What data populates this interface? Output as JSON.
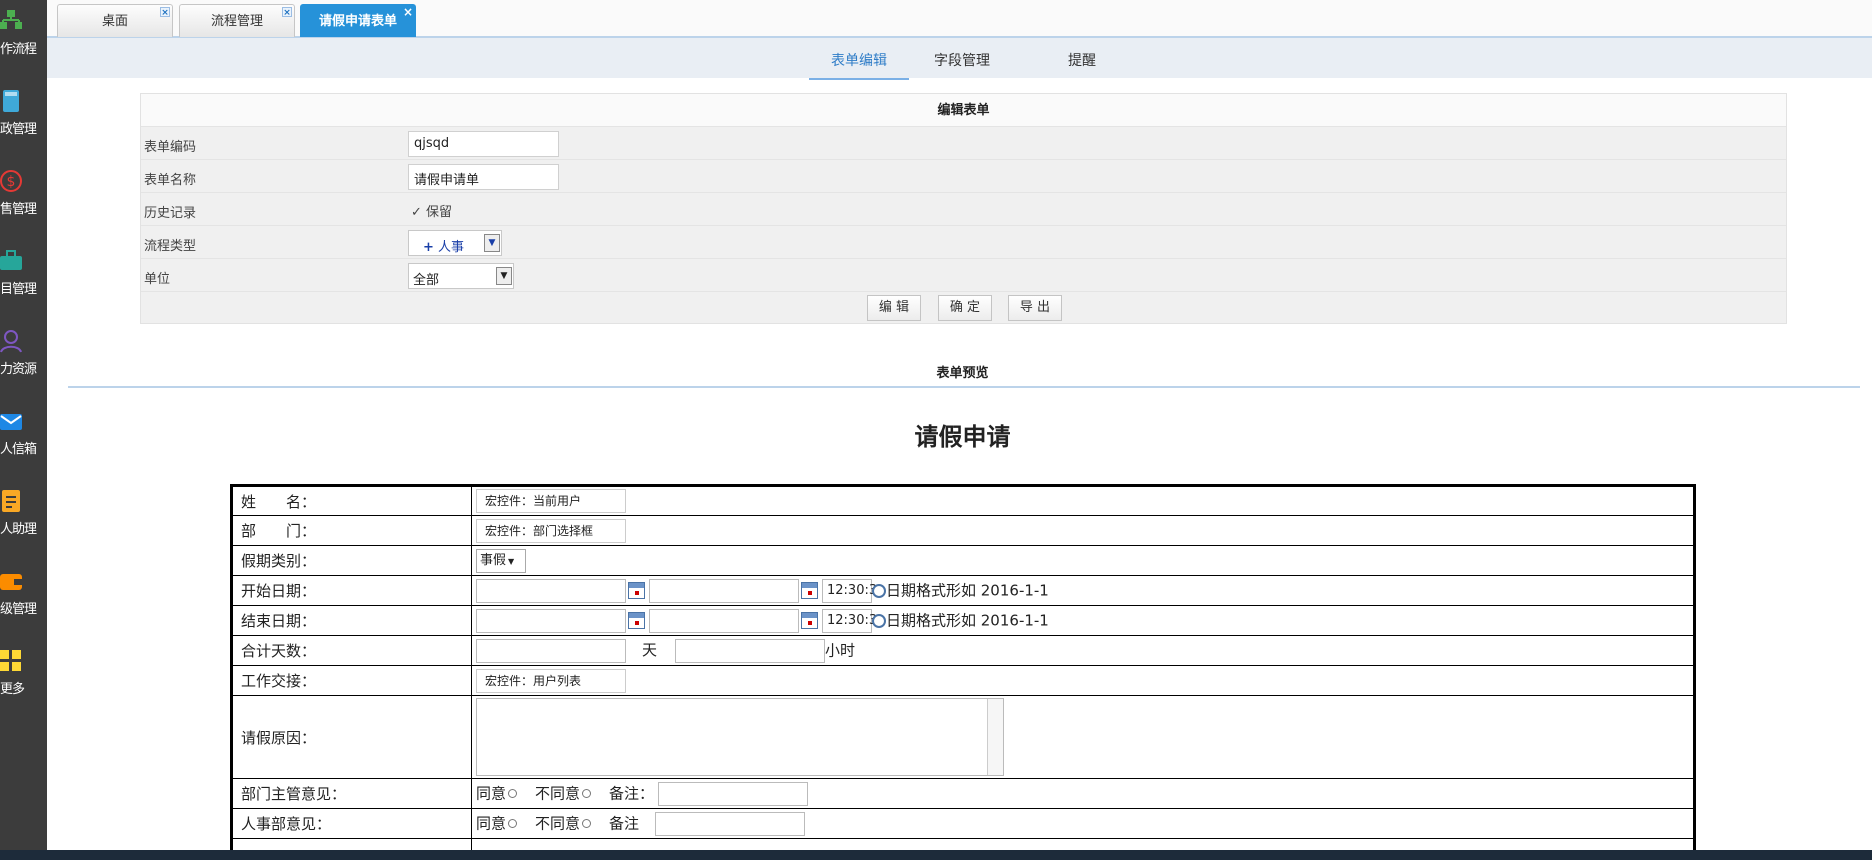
{
  "sidebar": {
    "items": [
      {
        "label": "作流程",
        "icon": "workflow-icon",
        "color": "#4caf50"
      },
      {
        "label": "政管理",
        "icon": "book-icon",
        "color": "#3fa9d9"
      },
      {
        "label": "售管理",
        "icon": "dollar-icon",
        "color": "#e53935"
      },
      {
        "label": "目管理",
        "icon": "project-icon",
        "color": "#26a69a"
      },
      {
        "label": "力资源",
        "icon": "person-icon",
        "color": "#7e57c2"
      },
      {
        "label": "人信箱",
        "icon": "mail-icon",
        "color": "#1e88e5"
      },
      {
        "label": "人助理",
        "icon": "assistant-icon",
        "color": "#f9a825"
      },
      {
        "label": "级管理",
        "icon": "wallet-icon",
        "color": "#fb8c00"
      },
      {
        "label": "更多",
        "icon": "grid-icon",
        "color": "#fdd835"
      }
    ]
  },
  "tabs": [
    {
      "label": "桌面",
      "active": false
    },
    {
      "label": "流程管理",
      "active": false
    },
    {
      "label": "请假申请表单",
      "active": true
    }
  ],
  "tab_close": "×",
  "subnav": [
    {
      "label": "表单编辑",
      "active": true
    },
    {
      "label": "字段管理",
      "active": false
    },
    {
      "label": "提醒",
      "active": false
    }
  ],
  "form": {
    "title": "编辑表单",
    "code_label": "表单编码",
    "code_value": "qjsqd",
    "name_label": "表单名称",
    "name_value": "请假申请单",
    "history_label": "历史记录",
    "history_check": "✓",
    "history_option": "保留",
    "type_label": "流程类型",
    "type_value": "人事",
    "unit_label": "单位",
    "unit_value": "全部",
    "buttons": {
      "edit": "编 辑",
      "confirm": "确 定",
      "export": "导 出"
    }
  },
  "preview": {
    "title": "表单预览",
    "doc_title": "请假申请",
    "rows": {
      "name": {
        "label": "姓　　名：",
        "value": "宏控件：当前用户"
      },
      "dept": {
        "label": "部　　门：",
        "value": "宏控件：部门选择框"
      },
      "leave_type": {
        "label": "假期类别：",
        "value": "事假"
      },
      "start": {
        "label": "开始日期：",
        "time": "12:30:3",
        "hint": "日期格式形如 2016-1-1"
      },
      "end": {
        "label": "结束日期：",
        "time": "12:30:3",
        "hint": "日期格式形如 2016-1-1"
      },
      "days": {
        "label": "合计天数：",
        "unit_day": "天",
        "unit_hour": "小时"
      },
      "handover": {
        "label": "工作交接：",
        "value": "宏控件：用户列表"
      },
      "reason": {
        "label": "请假原因："
      },
      "dept_opinion": {
        "label": "部门主管意见：",
        "agree": "同意",
        "disagree": "不同意",
        "remark": "备注："
      },
      "hr_opinion": {
        "label": "人事部意见：",
        "agree": "同意",
        "disagree": "不同意",
        "remark": "备注"
      }
    }
  }
}
